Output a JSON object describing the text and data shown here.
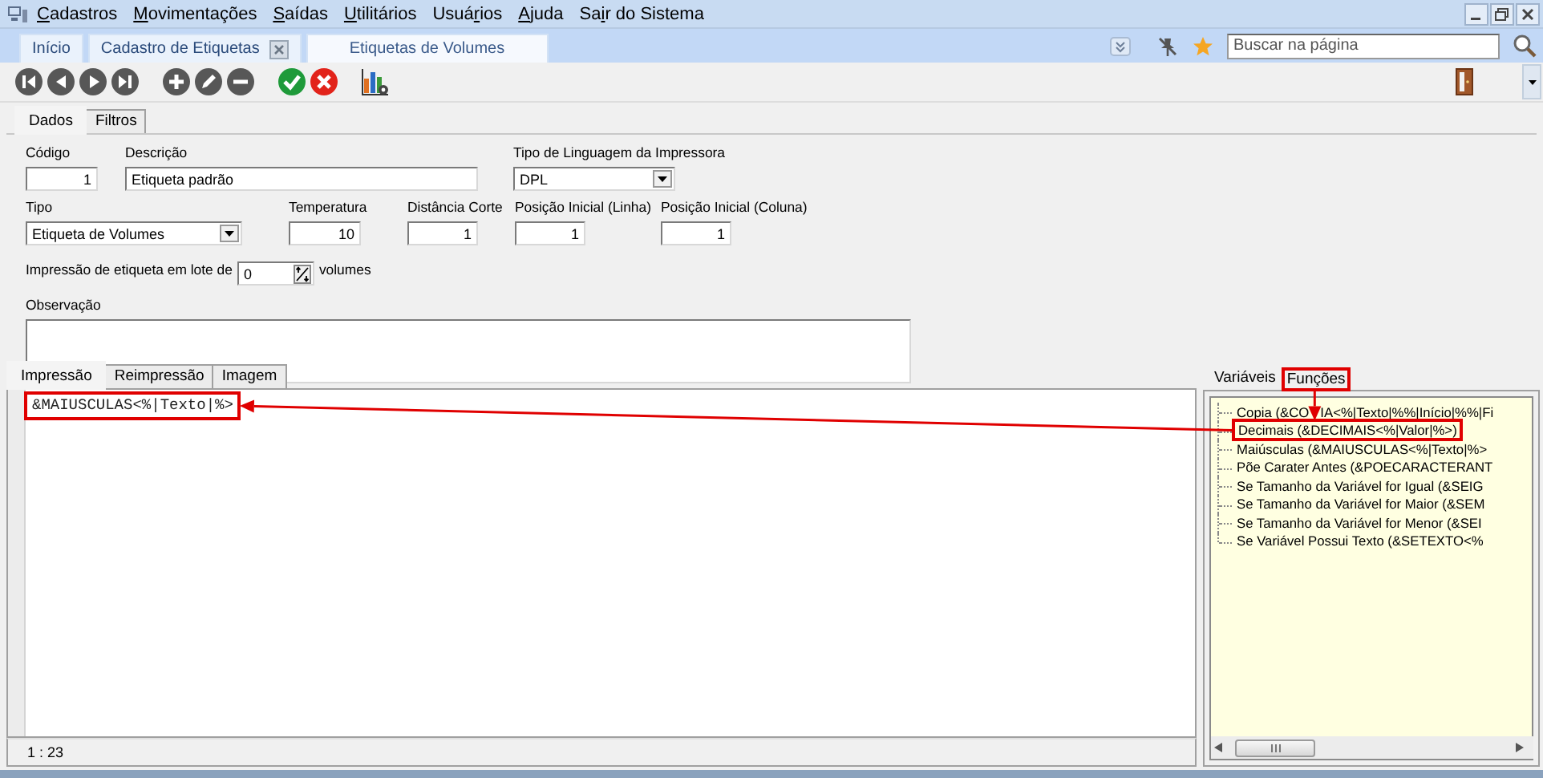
{
  "menu": {
    "items": [
      {
        "key": "C",
        "after": "adastros"
      },
      {
        "key": "M",
        "after": "ovimentações"
      },
      {
        "key": "S",
        "after": "aídas"
      },
      {
        "key": "U",
        "after": "tilitários"
      },
      {
        "before": "Usuá",
        "key": "r",
        "after": "ios"
      },
      {
        "key": "A",
        "after": "juda"
      },
      {
        "before": "Sa",
        "key": "i",
        "after": "r do Sistema"
      }
    ]
  },
  "page_tabs": [
    {
      "label": "Início",
      "selected": false,
      "closable": false
    },
    {
      "label": "Cadastro de Etiquetas",
      "selected": false,
      "closable": true
    },
    {
      "label": "Etiquetas de Volumes",
      "selected": true,
      "closable": false
    }
  ],
  "search": {
    "placeholder": "Buscar na página"
  },
  "toolbar": [
    {
      "kind": "first"
    },
    {
      "kind": "prev"
    },
    {
      "kind": "next"
    },
    {
      "kind": "last"
    },
    {
      "kind": "gap"
    },
    {
      "kind": "add"
    },
    {
      "kind": "edit"
    },
    {
      "kind": "remove"
    },
    {
      "kind": "gap"
    },
    {
      "kind": "confirm"
    },
    {
      "kind": "cancel"
    },
    {
      "kind": "gap"
    },
    {
      "kind": "report"
    }
  ],
  "form_tabs": [
    {
      "label": "Dados",
      "selected": true
    },
    {
      "label": "Filtros",
      "selected": false
    }
  ],
  "fields": [
    [
      {
        "label": "Código",
        "value": "1",
        "kind": "number"
      },
      {
        "label": "Descrição",
        "value": "Etiqueta padrão",
        "kind": "text"
      },
      {
        "label": "Tipo de Linguagem da Impressora",
        "value": "DPL",
        "kind": "select"
      }
    ],
    [
      {
        "label": "Tipo",
        "value": "Etiqueta de Volumes",
        "kind": "select"
      },
      {
        "label": "Temperatura",
        "value": "10",
        "kind": "number"
      },
      {
        "label": "Distância Corte",
        "value": "1",
        "kind": "number"
      },
      {
        "label": "Posição Inicial (Linha)",
        "value": "1",
        "kind": "number"
      },
      {
        "label": "Posição Inicial (Coluna)",
        "value": "1",
        "kind": "number"
      }
    ]
  ],
  "batch": {
    "label": "Impressão de etiqueta em lote de",
    "value": "0",
    "suffix": "volumes"
  },
  "observation": {
    "label": "Observação"
  },
  "print_tabs": [
    {
      "label": "Impressão",
      "selected": true
    },
    {
      "label": "Reimpressão",
      "selected": false
    },
    {
      "label": "Imagem",
      "selected": false
    }
  ],
  "editor": {
    "text": "&MAIUSCULAS<%|Texto|%>",
    "annotated": true,
    "cursor": "1 : 23"
  },
  "side_tabs": [
    {
      "label": "Variáveis",
      "selected": false,
      "annotated": false
    },
    {
      "label": "Funções",
      "selected": true,
      "annotated": true
    }
  ],
  "functions": [
    {
      "label": "Copia (&CO",
      "label_rest": "IA<%|Texto|%%|Início|%%|Fi",
      "annotated": false
    },
    {
      "label": "Decimais (&DECIMAIS<%|Valor|%>)",
      "annotated": true
    },
    {
      "label": "Maiúsculas (&MAIUSCULAS<%|Texto|%>",
      "annotated": false
    },
    {
      "label": "Põe Carater Antes (&POECARACTERANT",
      "annotated": false
    },
    {
      "label": "Se Tamanho da Variável for Igual (&SEIG",
      "annotated": false
    },
    {
      "label": "Se Tamanho da Variável for Maior (&SEM",
      "annotated": false
    },
    {
      "label": "Se Tamanho da Variável for Menor (&SEI",
      "annotated": false
    },
    {
      "label": "Se Variável Possui Texto (&SETEXTO<%",
      "annotated": false
    }
  ]
}
